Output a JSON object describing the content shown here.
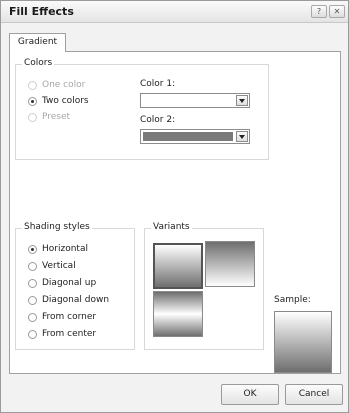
{
  "window": {
    "title": "Fill Effects"
  },
  "titlebar_buttons": {
    "help": "?",
    "close": "✕"
  },
  "tabs": [
    {
      "label": "Gradient"
    }
  ],
  "colors_group": {
    "legend": "Colors",
    "options": [
      {
        "label": "One color",
        "state": "disabled"
      },
      {
        "label": "Two colors",
        "state": "checked"
      },
      {
        "label": "Preset",
        "state": "disabled"
      }
    ],
    "color1": {
      "label": "Color 1:",
      "value_hex": "#ffffff"
    },
    "color2": {
      "label": "Color 2:",
      "value_hex": "#7a7a7a"
    }
  },
  "shading_group": {
    "legend": "Shading styles",
    "options": [
      {
        "label": "Horizontal",
        "checked": true
      },
      {
        "label": "Vertical",
        "checked": false
      },
      {
        "label": "Diagonal up",
        "checked": false
      },
      {
        "label": "Diagonal down",
        "checked": false
      },
      {
        "label": "From corner",
        "checked": false
      },
      {
        "label": "From center",
        "checked": false
      }
    ]
  },
  "variants_group": {
    "legend": "Variants"
  },
  "sample": {
    "label": "Sample:"
  },
  "buttons": {
    "ok": "OK",
    "cancel": "Cancel"
  }
}
